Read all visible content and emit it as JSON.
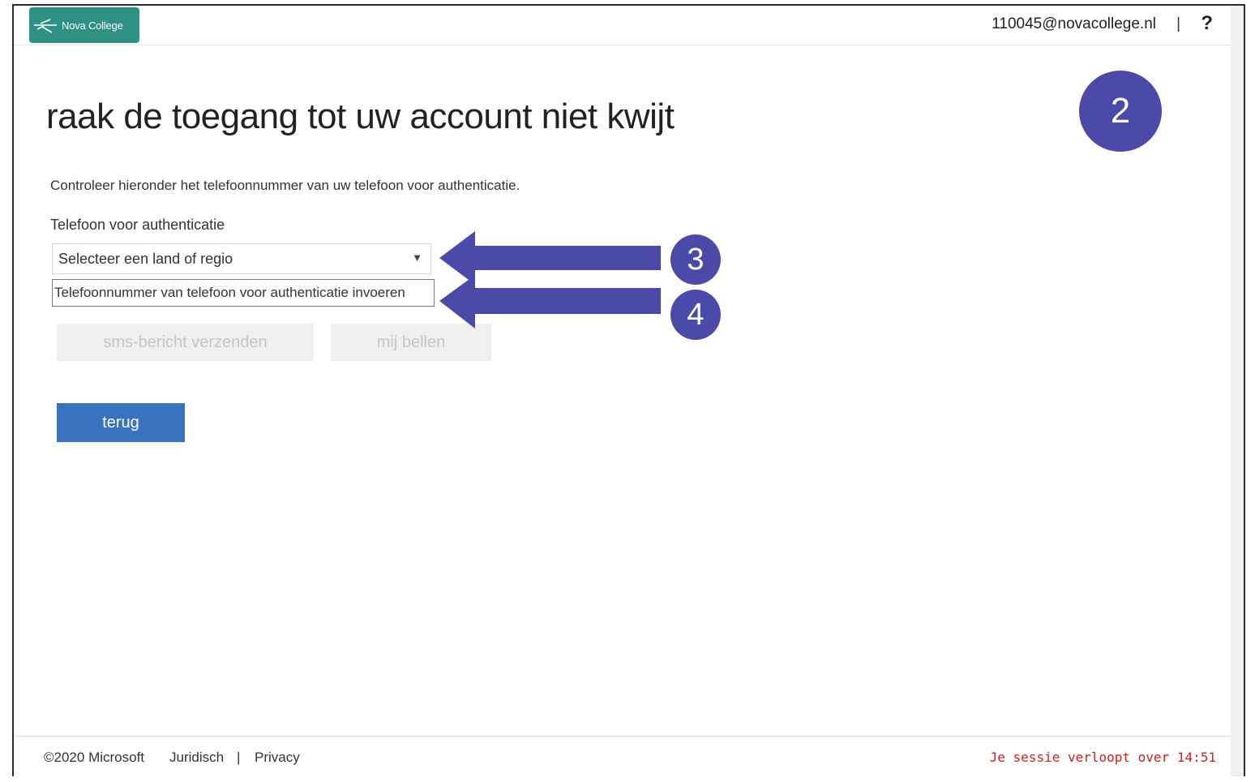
{
  "header": {
    "logo_text": "Nova College",
    "user_email": "110045@novacollege.nl",
    "separator": "|",
    "help_label": "?"
  },
  "page": {
    "title": "raak de toegang tot uw account niet kwijt",
    "description": "Controleer hieronder het telefoonnummer van uw telefoon voor authenticatie.",
    "field_label": "Telefoon voor authenticatie"
  },
  "form": {
    "country_select_value": "Selecteer een land of regio",
    "phone_placeholder": "Telefoonnummer van telefoon voor authenticatie invoeren",
    "sms_button": "sms-bericht verzenden",
    "call_button": "mij bellen",
    "back_button": "terug"
  },
  "annotations": {
    "step2": "2",
    "step3": "3",
    "step4": "4",
    "color": "#4c4aa8"
  },
  "footer": {
    "copyright": "©2020 Microsoft",
    "legal": "Juridisch",
    "separator": "|",
    "privacy": "Privacy",
    "session": "Je sessie verloopt over 14:51"
  },
  "colors": {
    "logo_bg": "#2e9184",
    "primary_button": "#3a73bd",
    "session_text": "#d21f1f"
  }
}
